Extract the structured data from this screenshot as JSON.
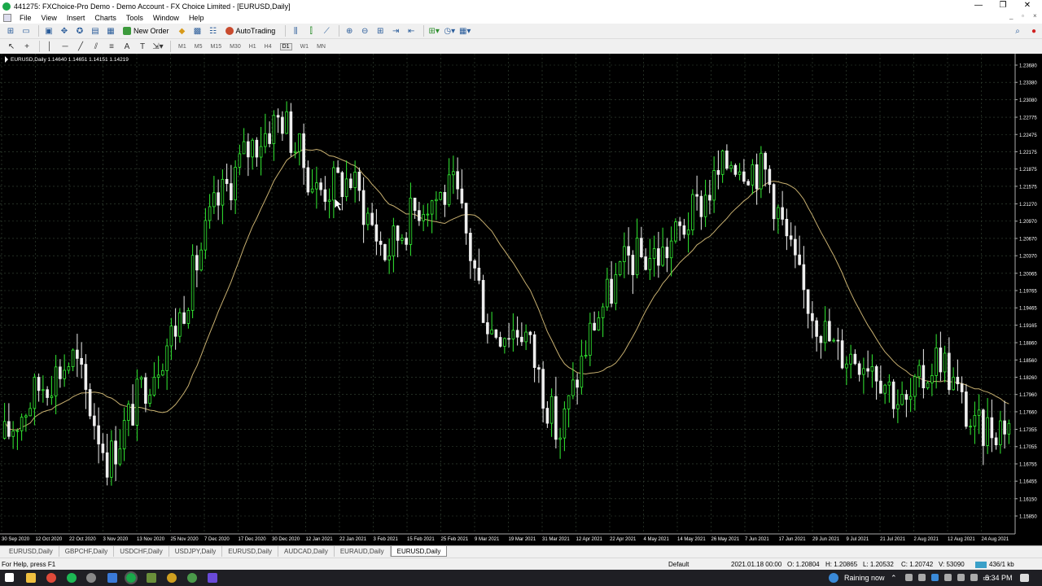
{
  "window": {
    "title": "441275: FXChoice-Pro Demo - Demo Account - FX Choice Limited - [EURUSD,Daily]",
    "controls": [
      "—",
      "❐",
      "✕"
    ]
  },
  "menu": {
    "items": [
      "File",
      "View",
      "Insert",
      "Charts",
      "Tools",
      "Window",
      "Help"
    ],
    "mdi_controls": [
      "_",
      "▫",
      "×"
    ]
  },
  "toolbar": {
    "new_order_label": "New Order",
    "autotrading_label": "AutoTrading",
    "timeframes": [
      "M1",
      "M5",
      "M15",
      "M30",
      "H1",
      "H4",
      "D1",
      "W1",
      "MN"
    ],
    "active_timeframe": "D1"
  },
  "chart": {
    "info_label": "EURUSD,Daily  1.14640 1.14651 1.14151 1.14219",
    "price_labels": [
      "1.23680",
      "1.23380",
      "1.23080",
      "1.22775",
      "1.22475",
      "1.22175",
      "1.21875",
      "1.21575",
      "1.21270",
      "1.20970",
      "1.20670",
      "1.20370",
      "1.20065",
      "1.19765",
      "1.19465",
      "1.19165",
      "1.18860",
      "1.18560",
      "1.18260",
      "1.17960",
      "1.17660",
      "1.17355",
      "1.17055",
      "1.16755",
      "1.16455",
      "1.16150",
      "1.15850"
    ],
    "date_labels": [
      "30 Sep 2020",
      "12 Oct 2020",
      "22 Oct 2020",
      "3 Nov 2020",
      "13 Nov 2020",
      "25 Nov 2020",
      "7 Dec 2020",
      "17 Dec 2020",
      "30 Dec 2020",
      "12 Jan 2021",
      "22 Jan 2021",
      "3 Feb 2021",
      "15 Feb 2021",
      "25 Feb 2021",
      "9 Mar 2021",
      "19 Mar 2021",
      "31 Mar 2021",
      "12 Apr 2021",
      "22 Apr 2021",
      "4 May 2021",
      "14 May 2021",
      "26 May 2021",
      "7 Jun 2021",
      "17 Jun 2021",
      "29 Jun 2021",
      "9 Jul 2021",
      "21 Jul 2021",
      "2 Aug 2021",
      "12 Aug 2021",
      "24 Aug 2021"
    ],
    "colors": {
      "background": "#000000",
      "grid": "#3a4a3a",
      "bull_candle": "#33ee33",
      "bear_candle": "#eeeeee",
      "moving_average": "#c8b070",
      "axis_text": "#ffffff"
    }
  },
  "chart_data": {
    "type": "candlestick",
    "symbol": "EURUSD",
    "timeframe": "Daily",
    "ylim": [
      1.1585,
      1.2368
    ],
    "grid": true,
    "close_path": [
      [
        "30 Sep 2020",
        1.172
      ],
      [
        "12 Oct 2020",
        1.181
      ],
      [
        "22 Oct 2020",
        1.186
      ],
      [
        "3 Nov 2020",
        1.168
      ],
      [
        "13 Nov 2020",
        1.181
      ],
      [
        "25 Nov 2020",
        1.192
      ],
      [
        "7 Dec 2020",
        1.211
      ],
      [
        "17 Dec 2020",
        1.222
      ],
      [
        "30 Dec 2020",
        1.228
      ],
      [
        "12 Jan 2021",
        1.215
      ],
      [
        "22 Jan 2021",
        1.217
      ],
      [
        "3 Feb 2021",
        1.204
      ],
      [
        "15 Feb 2021",
        1.213
      ],
      [
        "25 Feb 2021",
        1.215
      ],
      [
        "9 Mar 2021",
        1.191
      ],
      [
        "19 Mar 2021",
        1.191
      ],
      [
        "31 Mar 2021",
        1.172
      ],
      [
        "12 Apr 2021",
        1.192
      ],
      [
        "22 Apr 2021",
        1.203
      ],
      [
        "4 May 2021",
        1.204
      ],
      [
        "14 May 2021",
        1.212
      ],
      [
        "26 May 2021",
        1.221
      ],
      [
        "7 Jun 2021",
        1.218
      ],
      [
        "17 Jun 2021",
        1.198
      ],
      [
        "29 Jun 2021",
        1.187
      ],
      [
        "9 Jul 2021",
        1.186
      ],
      [
        "21 Jul 2021",
        1.177
      ],
      [
        "2 Aug 2021",
        1.187
      ],
      [
        "12 Aug 2021",
        1.173
      ],
      [
        "24 Aug 2021",
        1.175
      ]
    ]
  },
  "tabs": [
    "EURUSD,Daily",
    "GBPCHF,Daily",
    "USDCHF,Daily",
    "USDJPY,Daily",
    "EURUSD,Daily",
    "AUDCAD,Daily",
    "EURAUD,Daily",
    "EURUSD,Daily"
  ],
  "active_tab": 7,
  "status": {
    "help": "For Help, press F1",
    "profile": "Default",
    "datetime": "2021.01.18 00:00",
    "open": "O: 1.20804",
    "high": "H: 1.20865",
    "low": "L: 1.20532",
    "close": "C: 1.20742",
    "volume": "V: 53090",
    "traffic": "436/1 kb"
  },
  "taskbar": {
    "weather": "Raining now",
    "clock": "8:34 PM"
  }
}
